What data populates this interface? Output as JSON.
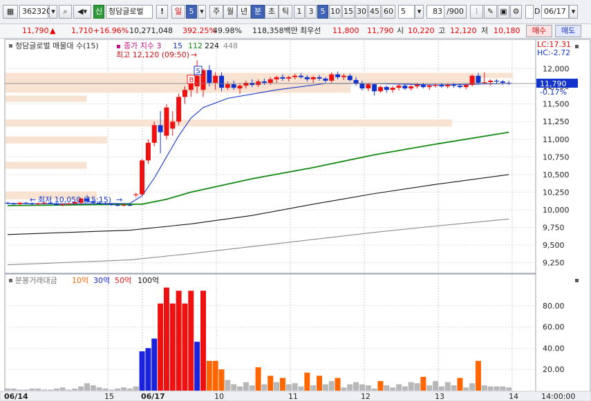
{
  "toolbar": {
    "code": "362320",
    "badge": "신",
    "name": "청담글로벌",
    "period_buttons": [
      "일",
      "5",
      "주",
      "월",
      "년",
      "분",
      "초",
      "틱"
    ],
    "minute_buttons": [
      "1",
      "3",
      "5",
      "10",
      "15",
      "30",
      "45",
      "60"
    ],
    "selected_minute": "5",
    "interval_value": "5",
    "count_value": "83",
    "count_total": "/900",
    "date_label": "D",
    "date_value": "06/17"
  },
  "quote": {
    "price": "11,790",
    "arrow": "▲",
    "change": "1,710",
    "change_pct": "+16.96%",
    "volume": "10,271,048",
    "volume_ratio": "392.25%",
    "turnover": "49.98%",
    "amount": "118,358백만",
    "best_ask_label": "최우선",
    "best_ask": "11,800",
    "best_bid": "11,790",
    "open_label": "시",
    "open": "10,220",
    "high_label": "고",
    "high": "12,120",
    "low_label": "저",
    "low": "10,180",
    "buy_label": "매수",
    "sell_label": "매도"
  },
  "colors": {
    "up": "#ee1111",
    "down": "#1133cc",
    "ma5": "#1133cc",
    "ma20": "#118811",
    "ma60": "#111111",
    "ma120": "#888888",
    "profile": "#f8e3d2",
    "vol_blue": "#1a22dd",
    "vol_red": "#ee1111",
    "vol_orange": "#ff6600",
    "vol_gray": "#b8b8b8"
  },
  "chart_data": [
    {
      "type": "candlestick",
      "title": "청담글로벌 매물대 수(15)",
      "ma_legend_label": "종가 지수 3",
      "ma_periods": [
        "15",
        "112",
        "224",
        "448"
      ],
      "high_annotation": "최고 12,120 (09:50)",
      "low_annotation": "최저 10,050 (15:15)",
      "side_labels": {
        "lc": "LC:17.31",
        "hc": "HC:-2.72"
      },
      "last_price_label": "11,790",
      "last_change_label": "-0.17%",
      "signals": [
        "S",
        "B"
      ],
      "y_ticks": [
        "12,000",
        "11,750",
        "11,500",
        "11,250",
        "11,000",
        "10,750",
        "10,500",
        "10,250",
        "10,000",
        "9,750",
        "9,500",
        "9,250"
      ],
      "ylim": [
        9100,
        12250
      ],
      "x_labels": [
        "06/14",
        "15",
        "06/17",
        "10",
        "11",
        "12",
        "13",
        "14",
        "14:00:00"
      ],
      "volume_profile": [
        {
          "low": 11870,
          "high": 11940,
          "strength": 1.0
        },
        {
          "low": 11780,
          "high": 11870,
          "strength": 0.93
        },
        {
          "low": 11660,
          "high": 11780,
          "strength": 0.68
        },
        {
          "low": 11530,
          "high": 11620,
          "strength": 0.16
        },
        {
          "low": 11180,
          "high": 11280,
          "strength": 0.88
        },
        {
          "low": 10940,
          "high": 11040,
          "strength": 0.2
        },
        {
          "low": 10580,
          "high": 10680,
          "strength": 0.16
        },
        {
          "low": 10150,
          "high": 10260,
          "strength": 0.18
        }
      ],
      "candles": [
        {
          "o": 10100,
          "h": 10110,
          "l": 10080,
          "c": 10090
        },
        {
          "o": 10090,
          "h": 10100,
          "l": 10070,
          "c": 10080
        },
        {
          "o": 10080,
          "h": 10110,
          "l": 10070,
          "c": 10100
        },
        {
          "o": 10100,
          "h": 10110,
          "l": 10080,
          "c": 10090
        },
        {
          "o": 10090,
          "h": 10100,
          "l": 10070,
          "c": 10080
        },
        {
          "o": 10080,
          "h": 10100,
          "l": 10070,
          "c": 10090
        },
        {
          "o": 10090,
          "h": 10110,
          "l": 10080,
          "c": 10100
        },
        {
          "o": 10100,
          "h": 10110,
          "l": 10080,
          "c": 10090
        },
        {
          "o": 10090,
          "h": 10100,
          "l": 10060,
          "c": 10070
        },
        {
          "o": 10070,
          "h": 10090,
          "l": 10050,
          "c": 10080
        },
        {
          "o": 10080,
          "h": 10100,
          "l": 10070,
          "c": 10090
        },
        {
          "o": 10090,
          "h": 10120,
          "l": 10080,
          "c": 10110
        },
        {
          "o": 10100,
          "h": 10170,
          "l": 10080,
          "c": 10160
        },
        {
          "o": 10160,
          "h": 10210,
          "l": 10100,
          "c": 10120
        },
        {
          "o": 10120,
          "h": 10140,
          "l": 10080,
          "c": 10100
        },
        {
          "o": 10100,
          "h": 10120,
          "l": 10080,
          "c": 10090
        },
        {
          "o": 10090,
          "h": 10110,
          "l": 10070,
          "c": 10080
        },
        {
          "o": 10080,
          "h": 10100,
          "l": 10060,
          "c": 10070
        },
        {
          "o": 10070,
          "h": 10090,
          "l": 10050,
          "c": 10060
        },
        {
          "o": 10060,
          "h": 10080,
          "l": 10050,
          "c": 10070
        },
        {
          "o": 10070,
          "h": 10090,
          "l": 10050,
          "c": 10060
        },
        {
          "o": 10220,
          "h": 10240,
          "l": 10180,
          "c": 10220
        },
        {
          "o": 10220,
          "h": 10720,
          "l": 10200,
          "c": 10700
        },
        {
          "o": 10700,
          "h": 11000,
          "l": 10650,
          "c": 10950
        },
        {
          "o": 10950,
          "h": 11250,
          "l": 10900,
          "c": 11200
        },
        {
          "o": 11200,
          "h": 11400,
          "l": 10800,
          "c": 11100
        },
        {
          "o": 11050,
          "h": 11500,
          "l": 11000,
          "c": 11450
        },
        {
          "o": 11150,
          "h": 11400,
          "l": 11050,
          "c": 11250
        },
        {
          "o": 11250,
          "h": 11650,
          "l": 11200,
          "c": 11600
        },
        {
          "o": 11600,
          "h": 11750,
          "l": 11500,
          "c": 11700
        },
        {
          "o": 11700,
          "h": 11900,
          "l": 11600,
          "c": 11850
        },
        {
          "o": 11750,
          "h": 12120,
          "l": 11650,
          "c": 11900
        },
        {
          "o": 11700,
          "h": 12000,
          "l": 11600,
          "c": 11980
        },
        {
          "o": 11980,
          "h": 12050,
          "l": 11750,
          "c": 11800
        },
        {
          "o": 11800,
          "h": 11950,
          "l": 11700,
          "c": 11900
        },
        {
          "o": 11900,
          "h": 11950,
          "l": 11680,
          "c": 11730
        },
        {
          "o": 11730,
          "h": 11820,
          "l": 11700,
          "c": 11780
        },
        {
          "o": 11780,
          "h": 11830,
          "l": 11700,
          "c": 11730
        },
        {
          "o": 11720,
          "h": 11790,
          "l": 11640,
          "c": 11760
        },
        {
          "o": 11760,
          "h": 11830,
          "l": 11720,
          "c": 11800
        },
        {
          "o": 11800,
          "h": 11850,
          "l": 11740,
          "c": 11770
        },
        {
          "o": 11770,
          "h": 11850,
          "l": 11740,
          "c": 11820
        },
        {
          "o": 11820,
          "h": 11860,
          "l": 11770,
          "c": 11800
        },
        {
          "o": 11800,
          "h": 11880,
          "l": 11770,
          "c": 11850
        },
        {
          "o": 11850,
          "h": 11900,
          "l": 11800,
          "c": 11880
        },
        {
          "o": 11880,
          "h": 11920,
          "l": 11830,
          "c": 11860
        },
        {
          "o": 11860,
          "h": 11900,
          "l": 11820,
          "c": 11880
        },
        {
          "o": 11880,
          "h": 11930,
          "l": 11850,
          "c": 11900
        },
        {
          "o": 11900,
          "h": 11940,
          "l": 11860,
          "c": 11880
        },
        {
          "o": 11880,
          "h": 11910,
          "l": 11820,
          "c": 11850
        },
        {
          "o": 11850,
          "h": 11900,
          "l": 11800,
          "c": 11880
        },
        {
          "o": 11880,
          "h": 11910,
          "l": 11830,
          "c": 11860
        },
        {
          "o": 11860,
          "h": 11880,
          "l": 11800,
          "c": 11830
        },
        {
          "o": 11830,
          "h": 11950,
          "l": 11800,
          "c": 11920
        },
        {
          "o": 11920,
          "h": 11960,
          "l": 11850,
          "c": 11880
        },
        {
          "o": 11880,
          "h": 11930,
          "l": 11840,
          "c": 11900
        },
        {
          "o": 11900,
          "h": 11930,
          "l": 11820,
          "c": 11840
        },
        {
          "o": 11840,
          "h": 11880,
          "l": 11760,
          "c": 11790
        },
        {
          "o": 11790,
          "h": 11830,
          "l": 11690,
          "c": 11720
        },
        {
          "o": 11720,
          "h": 11800,
          "l": 11680,
          "c": 11780
        },
        {
          "o": 11780,
          "h": 11790,
          "l": 11620,
          "c": 11680
        },
        {
          "o": 11680,
          "h": 11760,
          "l": 11660,
          "c": 11740
        },
        {
          "o": 11740,
          "h": 11760,
          "l": 11660,
          "c": 11700
        },
        {
          "o": 11700,
          "h": 11750,
          "l": 11660,
          "c": 11730
        },
        {
          "o": 11730,
          "h": 11780,
          "l": 11690,
          "c": 11760
        },
        {
          "o": 11760,
          "h": 11790,
          "l": 11700,
          "c": 11720
        },
        {
          "o": 11720,
          "h": 11770,
          "l": 11690,
          "c": 11750
        },
        {
          "o": 11750,
          "h": 11800,
          "l": 11720,
          "c": 11770
        },
        {
          "o": 11770,
          "h": 11800,
          "l": 11720,
          "c": 11740
        },
        {
          "o": 11740,
          "h": 11780,
          "l": 11700,
          "c": 11760
        },
        {
          "o": 11760,
          "h": 11790,
          "l": 11730,
          "c": 11770
        },
        {
          "o": 11770,
          "h": 11800,
          "l": 11730,
          "c": 11750
        },
        {
          "o": 11750,
          "h": 11790,
          "l": 11720,
          "c": 11770
        },
        {
          "o": 11770,
          "h": 11800,
          "l": 11730,
          "c": 11760
        },
        {
          "o": 11760,
          "h": 11790,
          "l": 11720,
          "c": 11740
        },
        {
          "o": 11740,
          "h": 11780,
          "l": 11710,
          "c": 11770
        },
        {
          "o": 11770,
          "h": 11920,
          "l": 11750,
          "c": 11900
        },
        {
          "o": 11900,
          "h": 11940,
          "l": 11770,
          "c": 11800
        },
        {
          "o": 11800,
          "h": 11950,
          "l": 11780,
          "c": 11810
        },
        {
          "o": 11810,
          "h": 11850,
          "l": 11760,
          "c": 11830
        },
        {
          "o": 11830,
          "h": 11850,
          "l": 11790,
          "c": 11820
        },
        {
          "o": 11820,
          "h": 11840,
          "l": 11770,
          "c": 11800
        },
        {
          "o": 11800,
          "h": 11830,
          "l": 11770,
          "c": 11790
        }
      ],
      "moving_averages": [
        {
          "period": "15",
          "points": [
            [
              0,
              10090
            ],
            [
              10,
              10085
            ],
            [
              20,
              10090
            ],
            [
              22,
              10200
            ],
            [
              24,
              10450
            ],
            [
              26,
              10750
            ],
            [
              28,
              11050
            ],
            [
              30,
              11300
            ],
            [
              32,
              11450
            ],
            [
              36,
              11580
            ],
            [
              44,
              11700
            ],
            [
              52,
              11790
            ],
            [
              60,
              11790
            ],
            [
              70,
              11770
            ],
            [
              82,
              11790
            ]
          ]
        },
        {
          "period": "112",
          "points": [
            [
              0,
              10060
            ],
            [
              22,
              10080
            ],
            [
              26,
              10150
            ],
            [
              30,
              10250
            ],
            [
              40,
              10440
            ],
            [
              50,
              10600
            ],
            [
              60,
              10780
            ],
            [
              70,
              10930
            ],
            [
              82,
              11100
            ]
          ]
        },
        {
          "period": "224",
          "points": [
            [
              0,
              9650
            ],
            [
              20,
              9710
            ],
            [
              30,
              9800
            ],
            [
              40,
              9920
            ],
            [
              50,
              10080
            ],
            [
              60,
              10230
            ],
            [
              70,
              10360
            ],
            [
              82,
              10500
            ]
          ]
        },
        {
          "period": "448",
          "points": [
            [
              0,
              9220
            ],
            [
              20,
              9290
            ],
            [
              30,
              9380
            ],
            [
              40,
              9480
            ],
            [
              50,
              9580
            ],
            [
              60,
              9680
            ],
            [
              70,
              9770
            ],
            [
              82,
              9870
            ]
          ]
        }
      ]
    },
    {
      "type": "bar",
      "title": "분봉거래대금",
      "legend": [
        {
          "label": "10억",
          "color": "#ff6600"
        },
        {
          "label": "30억",
          "color": "#1a22dd"
        },
        {
          "label": "50억",
          "color": "#ee1111"
        },
        {
          "label": "100억",
          "color": "#111111"
        }
      ],
      "y_ticks": [
        "80.00",
        "60.00",
        "40.00",
        "20.00"
      ],
      "ylim": [
        0,
        100
      ],
      "values": [
        2,
        2,
        1,
        1,
        2,
        2,
        1,
        1,
        2,
        3,
        1,
        2,
        4,
        7,
        5,
        3,
        2,
        1,
        2,
        3,
        2,
        4,
        37,
        40,
        49,
        82,
        97,
        82,
        94,
        82,
        94,
        46,
        94,
        28,
        28,
        20,
        10,
        6,
        4,
        8,
        5,
        22,
        6,
        14,
        8,
        12,
        6,
        7,
        4,
        17,
        5,
        14,
        6,
        9,
        12,
        3,
        6,
        8,
        6,
        5,
        2,
        9,
        5,
        3,
        6,
        4,
        8,
        7,
        13,
        5,
        9,
        4,
        8,
        5,
        12,
        3,
        7,
        28,
        5,
        4,
        4,
        4,
        3
      ],
      "bar_colors": [
        "g",
        "g",
        "g",
        "g",
        "g",
        "g",
        "g",
        "g",
        "g",
        "g",
        "g",
        "g",
        "g",
        "g",
        "g",
        "g",
        "g",
        "g",
        "g",
        "g",
        "g",
        "g",
        "b",
        "b",
        "b",
        "r",
        "r",
        "r",
        "r",
        "r",
        "r",
        "b",
        "r",
        "o",
        "o",
        "o",
        "g",
        "g",
        "g",
        "g",
        "g",
        "o",
        "g",
        "o",
        "g",
        "o",
        "g",
        "g",
        "g",
        "o",
        "g",
        "o",
        "g",
        "g",
        "o",
        "g",
        "g",
        "g",
        "g",
        "g",
        "g",
        "o",
        "g",
        "g",
        "g",
        "g",
        "g",
        "g",
        "o",
        "g",
        "g",
        "g",
        "g",
        "g",
        "o",
        "g",
        "g",
        "o",
        "g",
        "g",
        "g",
        "g",
        "g"
      ]
    }
  ]
}
